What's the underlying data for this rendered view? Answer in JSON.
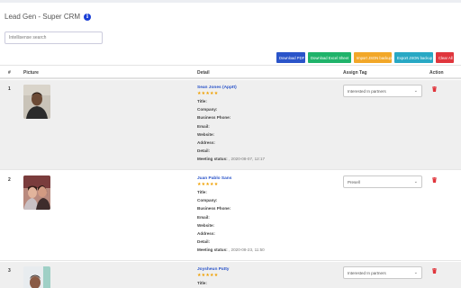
{
  "app": {
    "title": "Lead Gen - Super CRM",
    "info_icon": "info-circle-icon"
  },
  "search": {
    "placeholder": "Intellisense search"
  },
  "toolbar": {
    "download_pdf": "Download PDF",
    "download_excel": "Download Excel Sheet",
    "import_json": "Import JSON backup",
    "export_json": "Export JSON backup",
    "clear_all": "Clear All"
  },
  "table": {
    "headers": {
      "index": "#",
      "picture": "Picture",
      "detail": "Detail",
      "assign_tag": "Assign Tag",
      "action": "Action"
    },
    "field_labels": {
      "title": "Title:",
      "company": "Company:",
      "business_phone": "Business Phone:",
      "email": "Email:",
      "website": "Website:",
      "address": "Address:",
      "detail": "Detail:",
      "meeting_status": "Meeting status:"
    },
    "rows": [
      {
        "index": "1",
        "name": "Sean Jones (Apptt)",
        "stars": "★★★★★",
        "meeting": " , 2020-08-07, 12:17",
        "tag": "Interested In partners"
      },
      {
        "index": "2",
        "name": "Juan Pablo Sans",
        "stars": "★★★★★",
        "meeting": " , 2020-08-23, 11:50",
        "tag": "Presell"
      },
      {
        "index": "3",
        "name": "Joysheun Patty",
        "stars": "★★★★★",
        "meeting": "",
        "tag": "Interested In partners"
      }
    ]
  },
  "colors": {
    "accent": "#2a54c9",
    "star": "#f0a000",
    "delete": "#e0363d"
  }
}
